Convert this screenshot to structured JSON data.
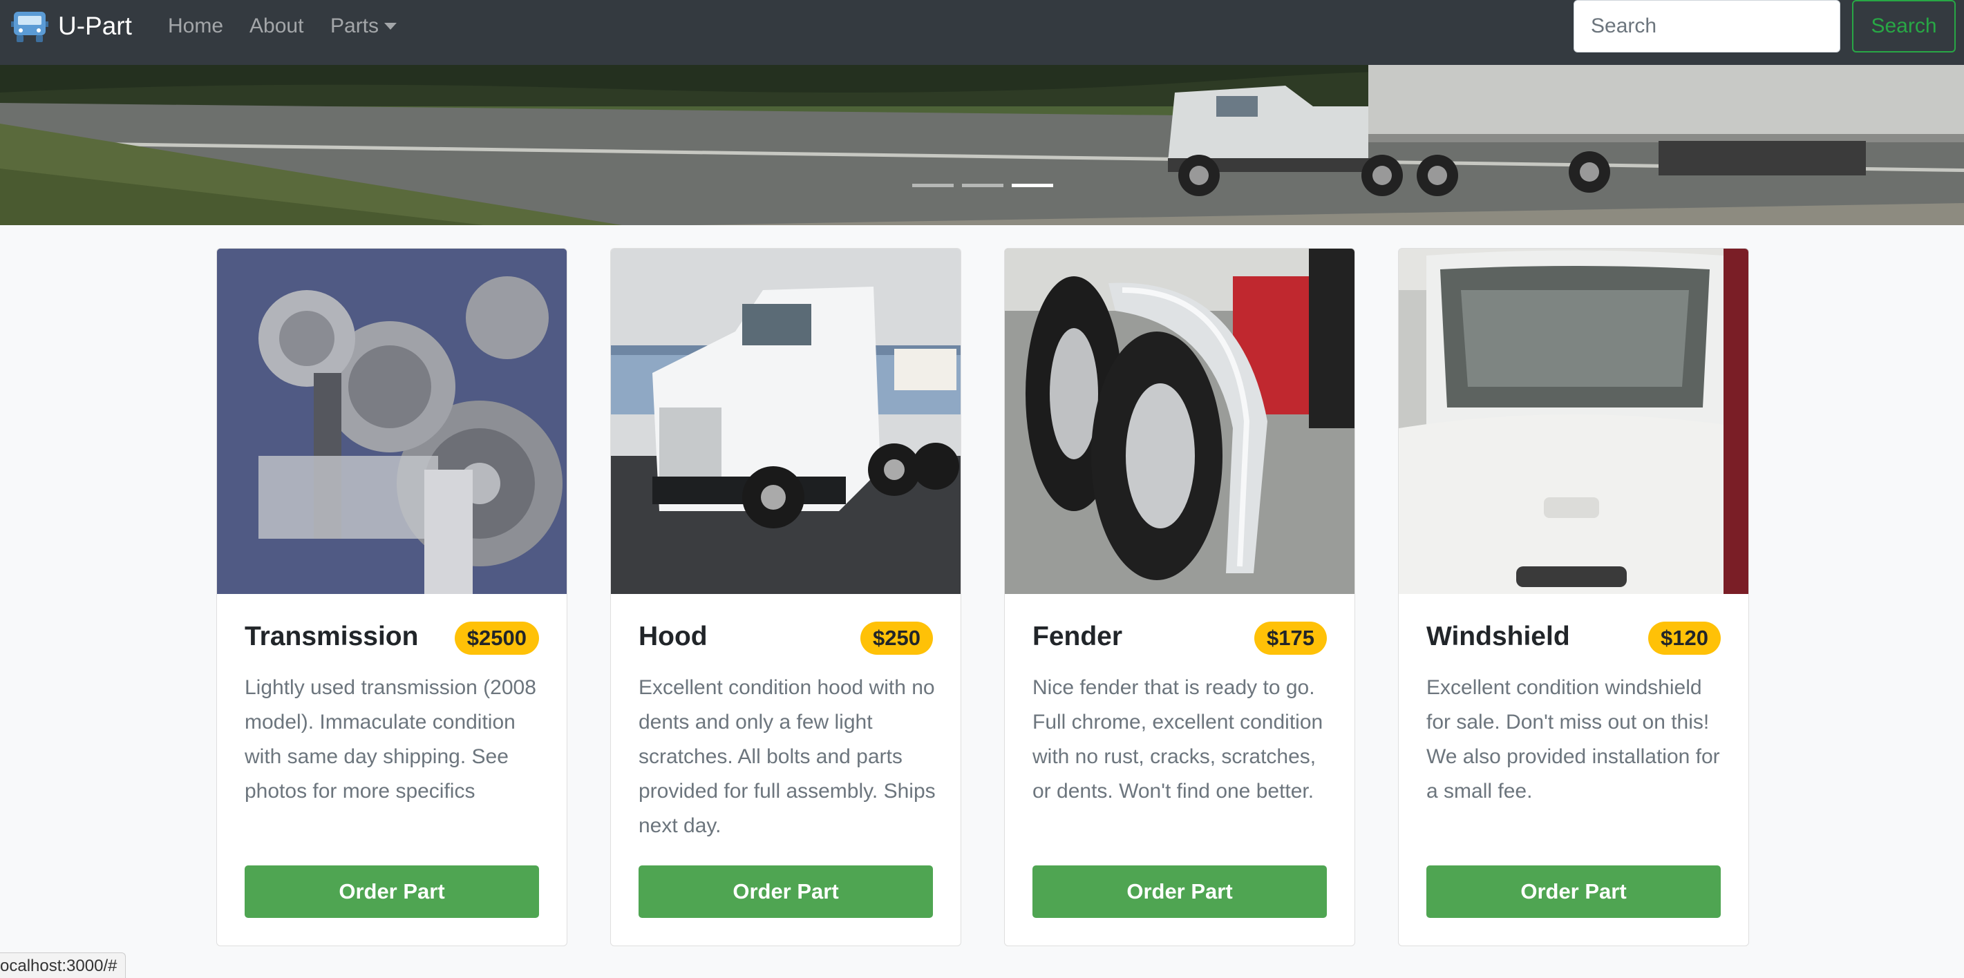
{
  "navbar": {
    "brand": "U-Part",
    "links": [
      {
        "label": "Home"
      },
      {
        "label": "About"
      },
      {
        "label": "Parts"
      }
    ],
    "search": {
      "placeholder": "Search",
      "value": "",
      "button_label": "Search"
    }
  },
  "carousel": {
    "indicator_count": 3,
    "active_index": 2
  },
  "cards": [
    {
      "title": "Transmission",
      "price": "$2500",
      "description": "Lightly used transmission (2008 model). Immaculate condition with same day shipping. See photos for more specifics",
      "button_label": "Order Part"
    },
    {
      "title": "Hood",
      "price": "$250",
      "description": "Excellent condition hood with no dents and only a few light scratches. All bolts and parts provided for full assembly. Ships next day.",
      "button_label": "Order Part"
    },
    {
      "title": "Fender",
      "price": "$175",
      "description": "Nice fender that is ready to go. Full chrome, excellent condition with no rust, cracks, scratches, or dents. Won't find one better.",
      "button_label": "Order Part"
    },
    {
      "title": "Windshield",
      "price": "$120",
      "description": "Excellent condition windshield for sale. Don't miss out on this! We also provided installation for a small fee.",
      "button_label": "Order Part"
    }
  ],
  "status_bar": {
    "url": "ocalhost:3000/#"
  },
  "colors": {
    "navbar": "#343a40",
    "accent_green": "#28a745",
    "button_green": "#4fa552",
    "price_badge": "#ffc107"
  }
}
